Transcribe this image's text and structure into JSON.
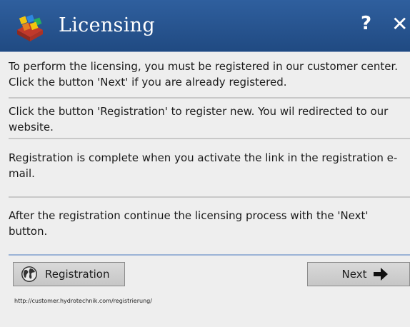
{
  "window": {
    "title": "Licensing",
    "help_label": "?",
    "close_label": "✕",
    "accent_color": "#2a5792"
  },
  "content": {
    "paragraphs": [
      "To perform the licensing, you must be registered in our customer center. Click the button 'Next' if you are already registered.",
      "Click the button 'Registration' to register new. You wil redirected to our website.",
      "Registration is complete when you activate the link in the registration e-mail.",
      "After the registration continue the licensing process with the 'Next' button."
    ]
  },
  "footer": {
    "registration_label": "Registration",
    "next_label": "Next",
    "url": "http://customer.hydrotechnik.com/registrierung/"
  },
  "icons": {
    "app": "cubes-icon",
    "registration": "globe-icon",
    "next": "arrow-right-icon"
  }
}
